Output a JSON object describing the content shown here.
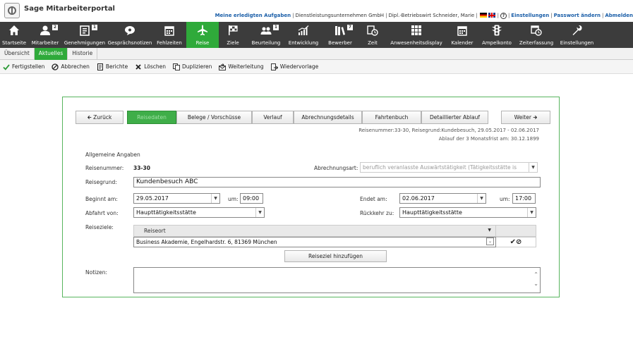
{
  "header": {
    "app_title": "Sage Mitarbeiterportal",
    "link_tasks": "Meine erledigten Aufgaben",
    "company": "Dienstleistungsunternehmen GmbH",
    "user": "Dipl.-Betriebswirt Schneider, Marie",
    "help_symbol": "?",
    "link_settings": "Einstellungen",
    "link_password": "Passwort ändern",
    "link_logout": "Abmelden"
  },
  "nav": {
    "items": [
      {
        "label": "Startseite",
        "icon": "home-icon"
      },
      {
        "label": "Mitarbeiter",
        "icon": "person-icon",
        "badge": "2"
      },
      {
        "label": "Genehmigungen",
        "icon": "clipboard-icon",
        "badge": "1"
      },
      {
        "label": "Gesprächsnotizen",
        "icon": "chat-icon"
      },
      {
        "label": "Fehlzeiten",
        "icon": "calendar-icon"
      },
      {
        "label": "Reise",
        "icon": "airplane-icon",
        "active": true
      },
      {
        "label": "Ziele",
        "icon": "flag-icon"
      },
      {
        "label": "Beurteilung",
        "icon": "group-icon",
        "badge": "1"
      },
      {
        "label": "Entwicklung",
        "icon": "chart-icon"
      },
      {
        "label": "Bewerber",
        "icon": "books-icon",
        "badge": "7"
      },
      {
        "label": "Zeit",
        "icon": "clock-icon"
      },
      {
        "label": "Anwesenheitsdisplay",
        "icon": "grid-icon"
      },
      {
        "label": "Kalender",
        "icon": "calendar-icon"
      },
      {
        "label": "Ampelkonto",
        "icon": "traffic-light-icon"
      },
      {
        "label": "Zeiterfassung",
        "icon": "calendar-clock-icon"
      },
      {
        "label": "Einstellungen",
        "icon": "wrench-icon"
      }
    ]
  },
  "subnav": {
    "tabs": [
      {
        "label": "Übersicht"
      },
      {
        "label": "Aktuelles",
        "active": true
      },
      {
        "label": "Historie"
      }
    ]
  },
  "toolbar": {
    "finish": "Fertigstellen",
    "cancel": "Abbrechen",
    "reports": "Berichte",
    "delete": "Löschen",
    "duplicate": "Duplizieren",
    "forward": "Weiterleitung",
    "resubmit": "Wiedervorlage"
  },
  "wizard": {
    "back": "Zurück",
    "tabs": [
      "Reisedaten",
      "Belege / Vorschüsse",
      "Verlauf",
      "Abrechnungsdetails",
      "Fahrtenbuch",
      "Detaillierter Ablauf"
    ],
    "next": "Weiter"
  },
  "meta": {
    "line1": "Reisenummer:33-30, Reisegrund:Kundebesuch, 29.05.2017 - 02.06.2017",
    "line2": "Ablauf der 3 Monatsfrist am: 30.12.1899"
  },
  "form": {
    "section": "Allgemeine Angaben",
    "reisenummer_label": "Reisenummer:",
    "reisenummer": "33-30",
    "abrechnungsart_label": "Abrechnungsart:",
    "abrechnungsart": "beruflich veranlasste Auswärtstätigkeit (Tätigkeitsstätte is",
    "reisegrund_label": "Reisegrund:",
    "reisegrund": "Kundenbesuch ABC",
    "beginnt_label": "Beginnt am:",
    "beginnt": "29.05.2017",
    "um_label": "um:",
    "beginnt_um": "09:00",
    "endet_label": "Endet am:",
    "endet": "02.06.2017",
    "endet_um": "17:00",
    "abfahrt_label": "Abfahrt von:",
    "abfahrt": "Haupttätigkeitsstätte",
    "rueckkehr_label": "Rückkehr zu:",
    "rueckkehr": "Haupttätigkeitsstätte",
    "reiseziele_label": "Reiseziele:",
    "grid_header": "Reiseort",
    "grid_row": "Business Akademie, Engelhardstr. 6, 81369 München",
    "add_destination": "Reiseziel hinzufügen",
    "notizen_label": "Notizen:"
  }
}
